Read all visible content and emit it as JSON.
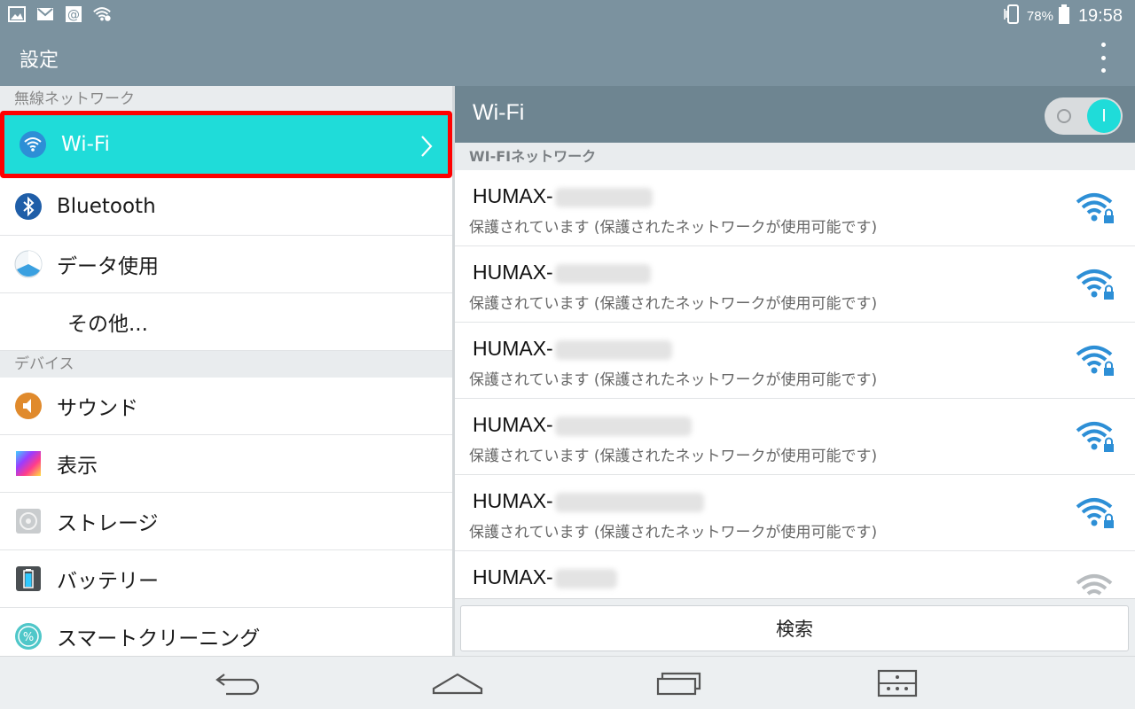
{
  "status_bar": {
    "icons": [
      "image-icon",
      "gmail-icon",
      "email-at-icon",
      "wifi-status-icon"
    ],
    "right_icons": [
      "vibrate-icon",
      "battery-icon"
    ],
    "battery_percent": "78%",
    "time": "19:58"
  },
  "app_bar": {
    "title": "設定"
  },
  "left_pane": {
    "sections": [
      {
        "header": "無線ネットワーク",
        "items": [
          {
            "label": "Wi-Fi",
            "icon": "wifi-icon",
            "selected": true
          },
          {
            "label": "Bluetooth",
            "icon": "bluetooth-icon"
          },
          {
            "label": "データ使用",
            "icon": "data-usage-icon"
          },
          {
            "label": "その他...",
            "icon": ""
          }
        ]
      },
      {
        "header": "デバイス",
        "items": [
          {
            "label": "サウンド",
            "icon": "sound-icon"
          },
          {
            "label": "表示",
            "icon": "display-icon"
          },
          {
            "label": "ストレージ",
            "icon": "storage-icon"
          },
          {
            "label": "バッテリー",
            "icon": "battery-icon"
          },
          {
            "label": "スマートクリーニング",
            "icon": "smart-cleaning-icon"
          }
        ]
      }
    ]
  },
  "right_pane": {
    "title": "Wi-Fi",
    "toggle": {
      "off_symbol": "O",
      "on_symbol": "I",
      "state": "on"
    },
    "section_header": "WI-FIネットワーク",
    "networks": [
      {
        "name": "HUMAX-",
        "status": "保護されています (保護されたネットワークが使用可能です)",
        "signal": "strong",
        "secured": true
      },
      {
        "name": "HUMAX-",
        "status": "保護されています (保護されたネットワークが使用可能です)",
        "signal": "strong",
        "secured": true
      },
      {
        "name": "HUMAX-",
        "status": "保護されています (保護されたネットワークが使用可能です)",
        "signal": "strong",
        "secured": true
      },
      {
        "name": "HUMAX-",
        "status": "保護されています (保護されたネットワークが使用可能です)",
        "signal": "strong",
        "secured": true
      },
      {
        "name": "HUMAX-",
        "status": "保護されています (保護されたネットワークが使用可能です)",
        "signal": "strong",
        "secured": true
      },
      {
        "name": "HUMAX-",
        "status": "",
        "signal": "weak",
        "secured": false
      }
    ],
    "scan_button": "検索"
  },
  "nav_bar": {
    "buttons": [
      "back-icon",
      "home-icon",
      "recent-apps-icon",
      "menu-icon"
    ]
  },
  "colors": {
    "bar": "#7b929f",
    "header_dark": "#6e8591",
    "accent": "#1fdcd9",
    "highlight_border": "#ff0000",
    "wifi_blue": "#2d8fd6"
  }
}
